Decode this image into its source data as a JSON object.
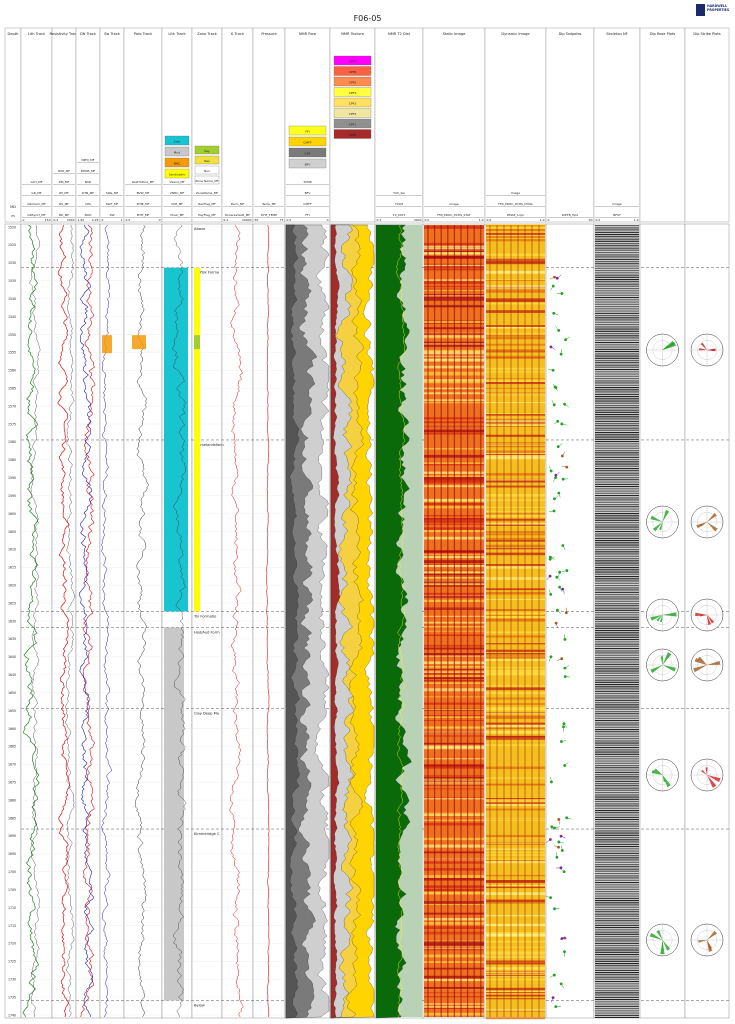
{
  "header": {
    "title": "F06-05",
    "logo_text": "HARDWELL PROPERTIES"
  },
  "tracks": [
    {
      "id": "depth",
      "name": "Depth"
    },
    {
      "id": "lith",
      "name": "Lith Track"
    },
    {
      "id": "resistivity",
      "name": "Resistivity Track"
    },
    {
      "id": "dn",
      "name": "DN Track"
    },
    {
      "id": "sw",
      "name": "Sw Track"
    },
    {
      "id": "poro",
      "name": "Poro Track"
    },
    {
      "id": "lith2",
      "name": "Lith Track"
    },
    {
      "id": "zone",
      "name": "Zone Track"
    },
    {
      "id": "k",
      "name": "K Track"
    },
    {
      "id": "pressure",
      "name": "Pressure"
    },
    {
      "id": "nmrpore",
      "name": "NMR Pore"
    },
    {
      "id": "nmrtexture",
      "name": "NMR Texture"
    },
    {
      "id": "nmrt2",
      "name": "NMR T2 Dist"
    },
    {
      "id": "static",
      "name": "Static Image"
    },
    {
      "id": "dynamic",
      "name": "Dynamic Image"
    },
    {
      "id": "dip",
      "name": "Dip Tadpoles"
    },
    {
      "id": "skeleton",
      "name": "Skeleton NF"
    },
    {
      "id": "diprose",
      "name": "Dip Rose Plots"
    },
    {
      "id": "strikerose",
      "name": "Dip Strike Plots"
    }
  ],
  "depth_axis": {
    "unit": "m",
    "md_label": "MD",
    "ticks": [
      "1520",
      "1525",
      "1530",
      "1535",
      "1540",
      "1545",
      "1550",
      "1555",
      "1560",
      "1565",
      "1570",
      "1575",
      "1580",
      "1585",
      "1590",
      "1595",
      "1600",
      "1605",
      "1610",
      "1615",
      "1620",
      "1625",
      "1630",
      "1635",
      "1640",
      "1645",
      "1650",
      "1655",
      "1660",
      "1665",
      "1670",
      "1675",
      "1680",
      "1685",
      "1690",
      "1695",
      "1700",
      "1705",
      "1710",
      "1715",
      "1720",
      "1725",
      "1730",
      "1735",
      "1740"
    ]
  },
  "zones": [
    "Above",
    "Ekofisk Forma",
    "Ommelandsfonn",
    "Tor Formatio",
    "Hod/Aud Form",
    "Clay Deep Ma",
    "Kimmeridge C",
    "Below"
  ],
  "nmr_texture_legend": [
    "CPF7",
    "CPF6",
    "CPF5",
    "CPF4",
    "CPF3",
    "CPF2",
    "CPF1",
    "CPF0"
  ],
  "nmr_pore_legend": [
    "FFI",
    "CMFF",
    "CBF",
    "BFV"
  ],
  "lith2_legend": [
    "Calc",
    "Mud",
    "NHC",
    "Sand/ssdrk"
  ],
  "zone_legend": [
    "Pay",
    "Res",
    "Non",
    "Zone Name_MF"
  ],
  "header_curves": {
    "lith": [
      "GRSynrt_MF",
      "GRchem_MF",
      "GR_MF",
      "LAH_MF"
    ],
    "resistivity": [
      "RD_MF",
      "RS_MF",
      "RT_MF",
      "RM_MF",
      "RXO_MF"
    ],
    "dn": [
      "NUD",
      "CPA",
      "DTN_MF",
      "NSD",
      "RHOB_MF",
      "NPHI_MF"
    ],
    "sw": [
      "SW",
      "SWT_MF",
      "SWe_MF"
    ],
    "poro": [
      "PHIT_MF",
      "PHIE_MF",
      "BVW_MF",
      "ResHCPore_MF"
    ],
    "lith2": [
      "VCalc_MF",
      "VSH_MF",
      "VNHC_MF",
      "VSand_MF"
    ],
    "zone": [
      "PayFlag_MF",
      "ResFlag_MF",
      "ZoneName_MF"
    ],
    "k": [
      "KCoarseValid_MF",
      "Perm_MF"
    ],
    "pressure": [
      "DHF_TEMP",
      "Temp_MF"
    ],
    "nmrpore": [
      "FFI",
      "CMFF",
      "BFV",
      "TCMR"
    ],
    "nmrt2": [
      "T2_DIST",
      "T2LM",
      "T2C_Sw"
    ],
    "static": [
      "FMI_PROC_PCHS_STAT",
      "image"
    ],
    "dynamic": [
      "DMAP_Ldyn",
      "FMI_PROC_PCHS_DYNA",
      "image"
    ],
    "dip": [
      "DIPTB_Hpd"
    ],
    "skeleton": [
      "NFST",
      "image"
    ]
  },
  "scale_ranges": {
    "lith": [
      "0",
      "150"
    ],
    "resistivity": [
      "0.2",
      "2000"
    ],
    "dn": [
      "1.95",
      "2.95"
    ],
    "sw": [
      "0",
      "1"
    ],
    "poro": [
      "0.5",
      "0"
    ],
    "k": [
      "0.1",
      "10000"
    ],
    "pressure": [
      "50",
      "75"
    ],
    "nmrpore": [
      "0.5",
      "0"
    ],
    "nmrt2": [
      "0.3",
      "3000"
    ],
    "static": [
      "0.0",
      "1.0"
    ],
    "dynamic": [
      "0.0",
      "1.0"
    ],
    "dip": [
      "0",
      "90"
    ],
    "skeleton": [
      "0.0",
      "1.0"
    ]
  },
  "colors": {
    "gamma": "#1a8a1a",
    "resistivity": "#d11",
    "density": "#d11",
    "neutron": "#22a",
    "hc": "#f59a0b",
    "calc": "#19c3cf",
    "sand": "#ffff00",
    "shale": "#b0b0b0",
    "pay": "#a3cf2e",
    "nmr_ffi": "#ffd400",
    "nmr_bfv": "#7a7a7a",
    "t2": "#0a6a0a",
    "dip_green": "#22a022",
    "dip_purple": "#7a2aa0",
    "dip_brown": "#a35a20"
  }
}
